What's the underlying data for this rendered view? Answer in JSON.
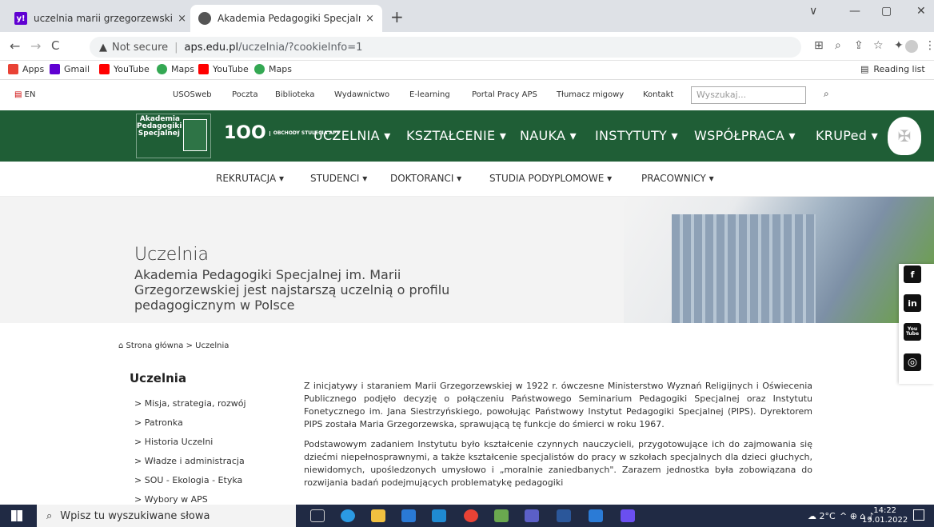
{
  "browser": {
    "tabs": [
      {
        "title": "uczelnia marii grzegorzewskiej -",
        "favicon": "yahoo-icon",
        "close": "×"
      },
      {
        "title": "Akademia Pedagogiki Specjalnej",
        "favicon": "globe-icon",
        "close": "×"
      }
    ],
    "new_tab": "+",
    "window_controls": [
      "∨",
      "—",
      "▢",
      "✕"
    ],
    "security_label": "Not secure",
    "url_host": "aps.edu.pl",
    "url_path": "/uczelnia/?cookieInfo=1",
    "bookmarks": [
      {
        "label": "Apps",
        "icon": "apps-grid-icon",
        "color": "#e94235"
      },
      {
        "label": "Gmail",
        "icon": "yahoo-icon",
        "color": "#6001d2"
      },
      {
        "label": "YouTube",
        "icon": "youtube-icon",
        "color": "#ff0000"
      },
      {
        "label": "Maps",
        "icon": "maps-pin-icon",
        "color": "#34a853"
      },
      {
        "label": "YouTube",
        "icon": "youtube-icon",
        "color": "#ff0000"
      },
      {
        "label": "Maps",
        "icon": "maps-pin-icon",
        "color": "#34a853"
      }
    ],
    "reading_list": "Reading list"
  },
  "site": {
    "lang": "EN",
    "top_links": [
      "USOSweb",
      "Poczta",
      "Biblioteka",
      "Wydawnictwo",
      "E-learning",
      "Portal Pracy APS",
      "Tłumacz migowy",
      "Kontakt"
    ],
    "search_placeholder": "Wyszukaj...",
    "logo_text": [
      "Akademia",
      "Pedagogiki",
      "Specjalnej"
    ],
    "hundred": "1OO",
    "hundred_caption": "OBCHODY STULECIA APS",
    "main_nav": [
      "UCZELNIA ▾",
      "KSZTAŁCENIE ▾",
      "NAUKA ▾",
      "INSTYTUTY ▾",
      "WSPÓŁPRACA ▾",
      "KRUPed ▾"
    ],
    "sub_nav": [
      "REKRUTACJA ▾",
      "STUDENCI ▾",
      "DOKTORANCI ▾",
      "STUDIA PODYPLOMOWE ▾",
      "PRACOWNICY ▾"
    ],
    "hero_title": "Uczelnia",
    "hero_subtitle": "Akademia Pedagogiki Specjalnej im. Marii Grzegorzewskiej jest najstarszą uczelnią o profilu pedagogicznym w Polsce",
    "breadcrumb": "Strona główna > Uczelnia",
    "sidebar_title": "Uczelnia",
    "sidebar_items": [
      "> Misja, strategia, rozwój",
      "> Patronka",
      "> Historia Uczelni",
      "> Władze i administracja",
      "> SOU - Ekologia - Etyka",
      "> Wybory w APS"
    ],
    "paragraphs": [
      "Z inicjatywy i staraniem Marii Grzegorzewskiej w 1922 r. ówczesne Ministerstwo Wyznań Religijnych i Oświecenia Publicznego podjęło decyzję o połączeniu Państwowego Seminarium Pedagogiki Specjalnej oraz Instytutu Fonetycznego im. Jana Siestrzyńskiego, powołując Państwowy Instytut Pedagogiki Specjalnej (PIPS). Dyrektorem PIPS została Maria Grzegorzewska, sprawującą tę funkcje do śmierci w roku 1967.",
      "Podstawowym zadaniem Instytutu było kształcenie czynnych nauczycieli, przygotowujące ich do zajmowania się dziećmi niepełnosprawnymi, a także kształcenie specjalistów do pracy w szkołach specjalnych dla dzieci głuchych, niewidomych, upośledzonych umysłowo i „moralnie zaniedbanych\". Zarazem jednostka była zobowiązana do rozwijania badań podejmujących problematykę pedagogiki"
    ],
    "social": [
      "f",
      "in",
      "You Tube",
      "◎"
    ]
  },
  "taskbar": {
    "search_placeholder": "Wpisz tu wyszukiwane słowa",
    "weather": "2°C",
    "time": "14:22",
    "date": "19.01.2022"
  }
}
